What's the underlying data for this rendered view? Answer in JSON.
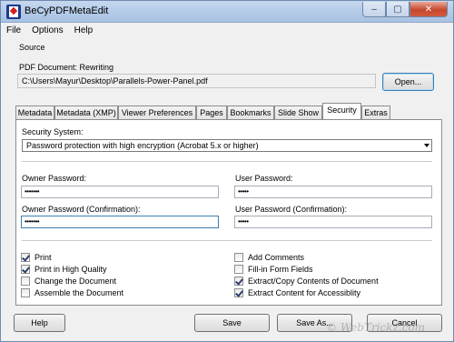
{
  "window": {
    "title": "BeCyPDFMetaEdit"
  },
  "caption_buttons": {
    "minimize": "–",
    "maximize": "▢",
    "close": "✕"
  },
  "menu": [
    "File",
    "Options",
    "Help"
  ],
  "source": {
    "group_label": "Source",
    "pdf_label": "PDF Document:  Rewriting",
    "path": "C:\\Users\\Mayur\\Desktop\\Parallels-Power-Panel.pdf",
    "open_button": "Open..."
  },
  "tabs": [
    "Metadata",
    "Metadata (XMP)",
    "Viewer Preferences",
    "Pages",
    "Bookmarks",
    "Slide Show",
    "Security",
    "Extras"
  ],
  "active_tab": "Security",
  "security": {
    "system_label": "Security System:",
    "system_value": "Password protection with high encryption (Acrobat 5.x or higher)",
    "owner_password_label": "Owner Password:",
    "owner_password_value": "•••••••",
    "user_password_label": "User Password:",
    "user_password_value": "•••••",
    "owner_confirm_label": "Owner Password (Confirmation):",
    "owner_confirm_value": "•••••••",
    "user_confirm_label": "User Password (Confirmation):",
    "user_confirm_value": "•••••",
    "permissions_left": [
      {
        "label": "Print",
        "checked": true
      },
      {
        "label": "Print in High Quality",
        "checked": true
      },
      {
        "label": "Change the Document",
        "checked": false
      },
      {
        "label": "Assemble the Document",
        "checked": false
      }
    ],
    "permissions_right": [
      {
        "label": "Add Comments",
        "checked": false
      },
      {
        "label": "Fill-in Form Fields",
        "checked": false
      },
      {
        "label": "Extract/Copy Contents of Document",
        "checked": true
      },
      {
        "label": "Extract Content for Accessiblity",
        "checked": true
      }
    ]
  },
  "footer": {
    "help": "Help",
    "save": "Save",
    "save_as": "Save As...",
    "cancel": "Cancel"
  },
  "watermark": "© WebTrickz.com"
}
